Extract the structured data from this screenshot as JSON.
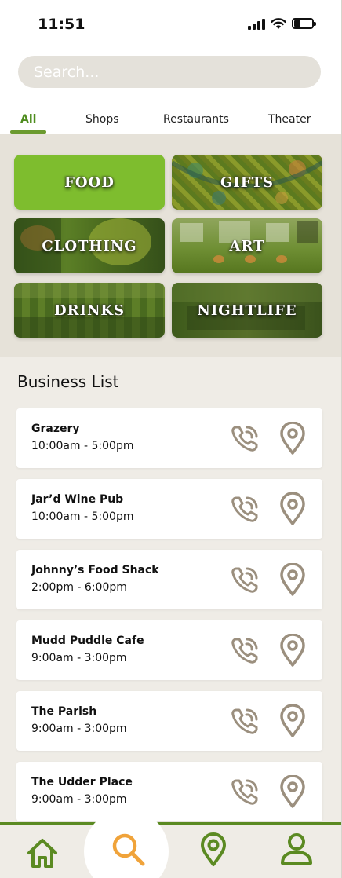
{
  "status_bar": {
    "time": "11:51"
  },
  "search": {
    "placeholder": "Search..."
  },
  "tabs": [
    {
      "label": "All",
      "active": true
    },
    {
      "label": "Shops"
    },
    {
      "label": "Restaurants"
    },
    {
      "label": "Theater"
    }
  ],
  "categories": [
    {
      "label": "FOOD"
    },
    {
      "label": "GIFTS"
    },
    {
      "label": "CLOTHING"
    },
    {
      "label": "ART"
    },
    {
      "label": "DRINKS"
    },
    {
      "label": "NIGHTLIFE"
    }
  ],
  "business_list": {
    "title": "Business List",
    "items": [
      {
        "name": "Grazery",
        "hours": "10:00am - 5:00pm"
      },
      {
        "name": "Jar’d Wine Pub",
        "hours": "10:00am - 5:00pm"
      },
      {
        "name": "Johnny’s Food Shack",
        "hours": "2:00pm - 6:00pm"
      },
      {
        "name": "Mudd Puddle Cafe",
        "hours": "9:00am - 3:00pm"
      },
      {
        "name": "The Parish",
        "hours": "9:00am - 3:00pm"
      },
      {
        "name": "The Udder Place",
        "hours": "9:00am - 3:00pm"
      }
    ]
  },
  "icons": {
    "call": "phone-call-icon",
    "location": "map-pin-icon",
    "nav": [
      "home-icon",
      "search-icon",
      "map-pin-icon",
      "profile-icon"
    ]
  },
  "colors": {
    "accent_green": "#5b8a22",
    "active_tab_green": "#4e8c1e",
    "food_tile_green": "#7ebd2e",
    "icon_taupe": "#9b8f7e",
    "search_orange": "#f0a33a",
    "background": "#efece6"
  }
}
